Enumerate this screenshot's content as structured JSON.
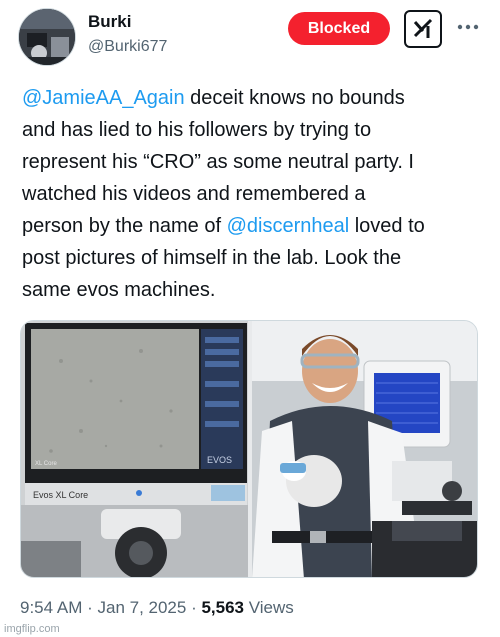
{
  "author": {
    "name": "Burki",
    "handle": "@Burki677",
    "blocked_label": "Blocked"
  },
  "icons": {
    "grok": "grok-icon",
    "more": "more-icon",
    "avatar": "avatar-image"
  },
  "tweet": {
    "line1_mention": "@JamieAA_Again",
    "line1_rest": " deceit knows no bounds",
    "line2": "and has lied to his followers by trying to",
    "line3": "represent his “CRO” as some neutral party. I",
    "line4": "watched his videos and remembered a",
    "line5_pre": "person by the name of ",
    "line5_mention": "@discernheal",
    "line5_post": " loved to",
    "line6": "post pictures of himself in the lab. Look the",
    "line7": "same evos machines."
  },
  "media": {
    "left_screen_brand": "EVOS",
    "left_device_label": "Evos XL Core",
    "left_screen_tag": "XL Core"
  },
  "meta": {
    "time": "9:54 AM",
    "sep1": " · ",
    "date": "Jan 7, 2025",
    "sep2": " · ",
    "views_count": "5,563",
    "views_label": " Views"
  },
  "watermark": "imgflip.com",
  "colors": {
    "link": "#1d9bf0",
    "blocked": "#f4212e",
    "secondary_text": "#536471"
  }
}
